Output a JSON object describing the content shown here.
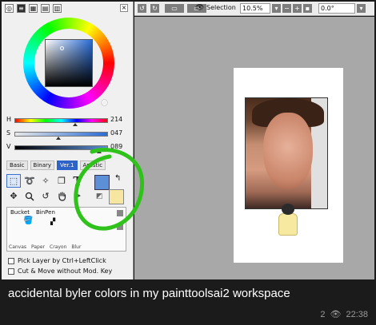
{
  "panel": {
    "icons": [
      "color-wheel-icon",
      "color-bars-icon",
      "swatch-grid-icon",
      "mixer-icon",
      "scratchpad-icon"
    ],
    "icon_glyphs": [
      "◎",
      "≡",
      "▦",
      "▤",
      "▥"
    ],
    "close_glyph": "×"
  },
  "color": {
    "primary": "#5b8fd6",
    "secondary": "#f6e6a0",
    "hsv": {
      "h_label": "H",
      "h_value": "214",
      "s_label": "S",
      "s_value": "047",
      "v_label": "V",
      "v_value": "089"
    }
  },
  "tool_tabs": [
    {
      "label": "Basic",
      "active": false
    },
    {
      "label": "Binary",
      "active": false
    },
    {
      "label": "Ver.1",
      "active": true
    },
    {
      "label": "Artistic",
      "active": false
    }
  ],
  "tools": [
    {
      "name": "rect-select-icon",
      "glyph": "⬚",
      "selected": true
    },
    {
      "name": "lasso-icon",
      "glyph": "➰",
      "selected": false
    },
    {
      "name": "magic-wand-icon",
      "glyph": "✧",
      "selected": false
    },
    {
      "name": "transform-icon",
      "glyph": "❐",
      "selected": false
    },
    {
      "name": "text-icon",
      "glyph": "T",
      "selected": false,
      "big": true
    },
    {
      "name": "move-icon",
      "glyph": "✥",
      "selected": false
    },
    {
      "name": "zoom-icon",
      "glyph": "🔍",
      "selected": false
    },
    {
      "name": "rotate-icon",
      "glyph": "↺",
      "selected": false
    },
    {
      "name": "hand-icon",
      "glyph": "✋",
      "selected": false
    },
    {
      "name": "eyedropper-icon",
      "glyph": "✒",
      "selected": false
    }
  ],
  "brushes": {
    "row1": [
      "Bucket",
      "BinPen"
    ],
    "row2": [
      "Canvas",
      "Paper",
      "Crayon",
      "Blur"
    ]
  },
  "options": [
    {
      "label": "Pick Layer by Ctrl+LeftClick",
      "checked": false
    },
    {
      "label": "Cut & Move without Mod. Key",
      "checked": false
    }
  ],
  "toolbar": {
    "selection_label": "Selection",
    "zoom": "10.5%",
    "rotation": "0.0°"
  },
  "caption": {
    "text": "accidental byler colors in my painttoolsai2 workspace",
    "views": "2",
    "time": "22:38"
  }
}
